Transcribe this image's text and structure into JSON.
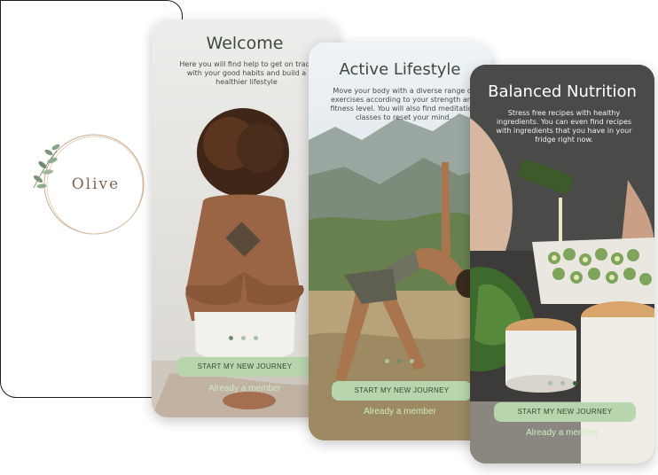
{
  "brand": {
    "name": "Olive"
  },
  "screens": [
    {
      "title": "Welcome",
      "description": "Here you will find help to get on track with your good habits and build a healthier lifestyle",
      "cta": "START MY NEW JOURNEY",
      "secondary": "Already a member",
      "active_dot": 0
    },
    {
      "title": "Active Lifestyle",
      "description": "Move your body with a diverse range of exercises according to your strength and fitness level. You will also find meditation classes to reset your mind.",
      "cta": "START MY NEW JOURNEY",
      "secondary": "Already a member",
      "active_dot": 1
    },
    {
      "title": "Balanced Nutrition",
      "description": "Stress free recipes with healthy ingredients. You can even find recipes with ingredients that you have in your fridge right now.",
      "cta": "START MY NEW JOURNEY",
      "secondary": "Already a member",
      "active_dot": 2
    }
  ],
  "colors": {
    "accent_green": "#b7d6ad",
    "member_text": "#cdebc2",
    "logo_text": "#7d6551"
  }
}
